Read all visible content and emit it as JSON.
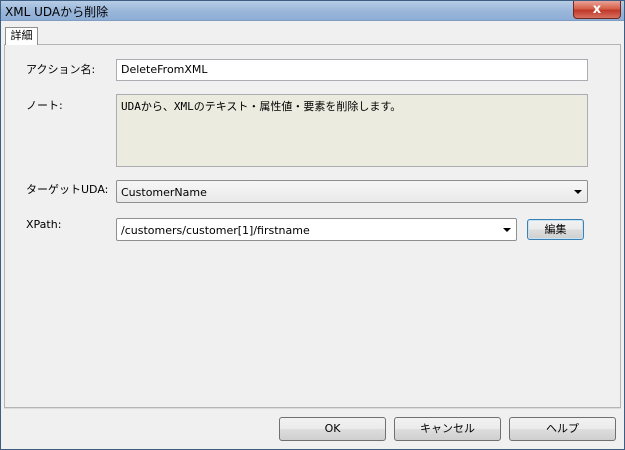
{
  "window": {
    "title": "XML UDAから削除",
    "close_label": "x"
  },
  "tabs": [
    {
      "label": "詳細"
    }
  ],
  "form": {
    "action_name_label": "アクション名:",
    "action_name_value": "DeleteFromXML",
    "note_label": "ノート:",
    "note_value": "UDAから、XMLのテキスト・属性値・要素を削除します。",
    "target_uda_label": "ターゲットUDA:",
    "target_uda_value": "CustomerName",
    "xpath_label": "XPath:",
    "xpath_value": "/customers/customer[1]/firstname",
    "edit_button_label": "編集"
  },
  "footer": {
    "ok_label": "OK",
    "cancel_label": "キャンセル",
    "help_label": "ヘルプ"
  }
}
